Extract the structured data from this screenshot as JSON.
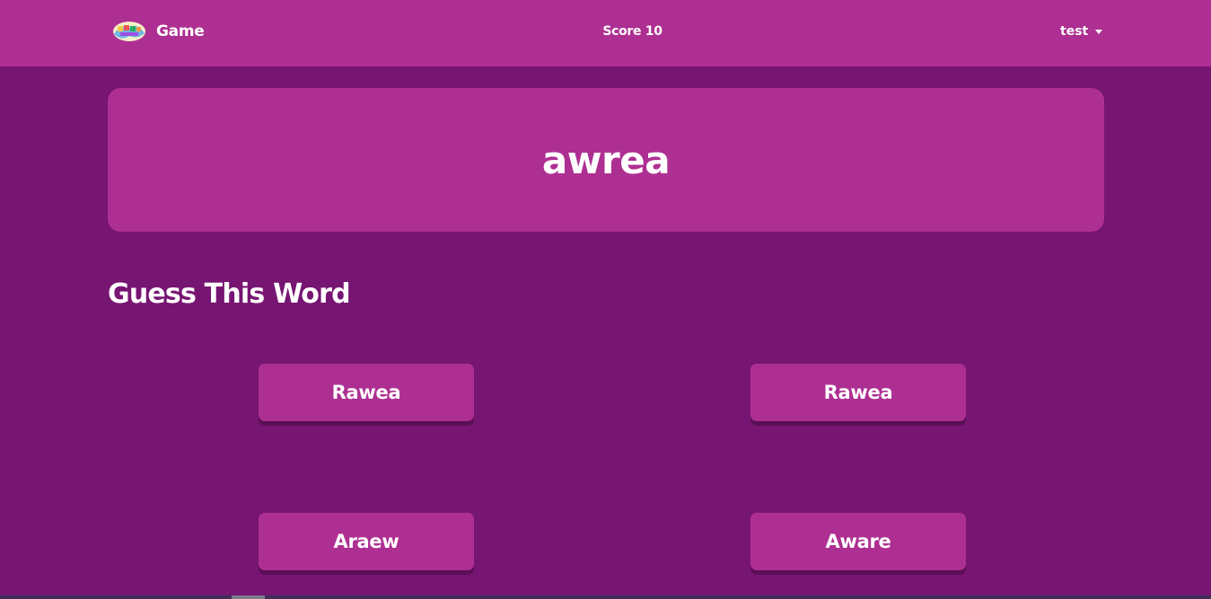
{
  "navbar": {
    "brand_label": "Game",
    "score_text": "Score 10",
    "user_label": "test"
  },
  "word_card": {
    "scrambled_word": "awrea"
  },
  "prompt": {
    "heading": "Guess This Word"
  },
  "options": [
    {
      "label": "Rawea"
    },
    {
      "label": "Rawea"
    },
    {
      "label": "Araew"
    },
    {
      "label": "Aware"
    }
  ],
  "colors": {
    "background": "#771572",
    "card": "#ae2f92",
    "button_shadow": "#5a0f55"
  }
}
